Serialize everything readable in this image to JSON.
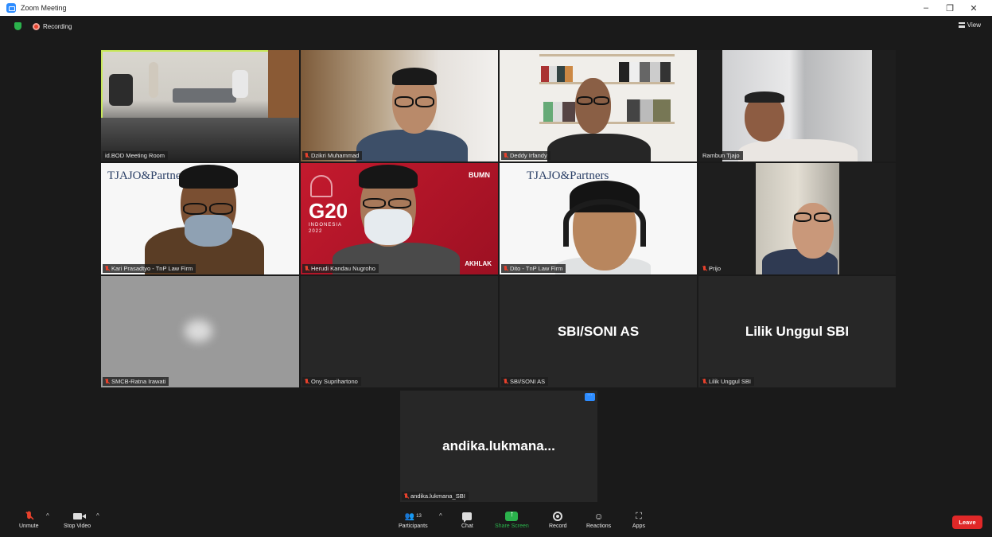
{
  "window": {
    "title": "Zoom Meeting"
  },
  "topbar": {
    "recording_label": "Recording",
    "view_label": "View"
  },
  "tiles": [
    {
      "name": "id.BOD Meeting Room"
    },
    {
      "name": "Dzikri Muhammad"
    },
    {
      "name": "Deddy Irfandy"
    },
    {
      "name": "Rambun Tjajo"
    },
    {
      "name": "Kari Prasadtyo - TnP Law Firm",
      "logo": "TJAJO&Partners"
    },
    {
      "name": "Herudi Kandau Nugroho",
      "g20_title": "G20",
      "g20_sub1": "INDONESIA",
      "g20_sub2": "2022",
      "akhlak": "AKHLAK",
      "bumn": "BUMN"
    },
    {
      "name": "Dito - TnP Law Firm",
      "logo": "TJAJO&Partners"
    },
    {
      "name": "Prijo"
    },
    {
      "name": "SMCB-Ratna Irawati"
    },
    {
      "name": "Ony Suprihartono"
    },
    {
      "name": "SBI/SONI AS",
      "display": "SBI/SONI AS"
    },
    {
      "name": "Lilik Unggul SBI",
      "display": "Lilik Unggul SBI"
    },
    {
      "name": "andika.lukmana_SBI",
      "display": "andika.lukmana..."
    }
  ],
  "toolbar": {
    "unmute": "Unmute",
    "stop_video": "Stop Video",
    "participants": "Participants",
    "participants_count": "13",
    "chat": "Chat",
    "share_screen": "Share Screen",
    "record": "Record",
    "reactions": "Reactions",
    "apps": "Apps",
    "leave": "Leave"
  },
  "colors": {
    "share_green": "#2bb24c",
    "leave_red": "#e02828",
    "active_border": "#c8e85a",
    "zoom_blue": "#2d8cff"
  }
}
